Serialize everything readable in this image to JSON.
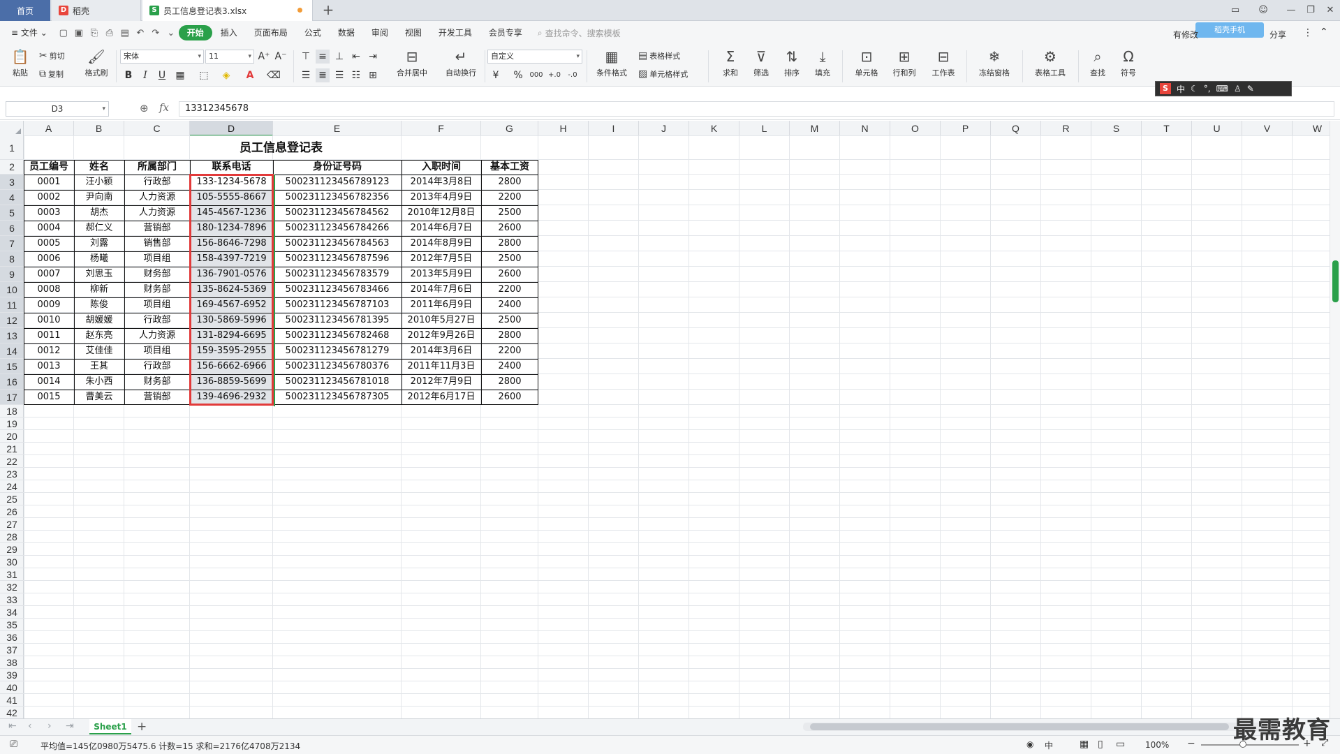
{
  "tabs": {
    "home": "首页",
    "daoke": "稻壳",
    "file": "员工信息登记表3.xlsx"
  },
  "menu": {
    "file": "文件",
    "items": [
      "开始",
      "插入",
      "页面布局",
      "公式",
      "数据",
      "审阅",
      "视图",
      "开发工具",
      "会员专享"
    ],
    "search_placeholder": "查找命令、搜索模板",
    "has_changes": "有修改",
    "share": "分享",
    "promo": "稻壳手机"
  },
  "ribbon": {
    "paste": "粘贴",
    "cut": "剪切",
    "copy": "复制",
    "format_painter": "格式刷",
    "font": "宋体",
    "font_size": "11",
    "number_format": "自定义",
    "merge_center": "合并居中",
    "auto_wrap": "自动换行",
    "table_style": "表格样式",
    "cond_format": "条件格式",
    "cell_style": "单元格样式",
    "sum": "求和",
    "filter": "筛选",
    "sort": "排序",
    "fill": "填充",
    "cell": "单元格",
    "row_col": "行和列",
    "worksheet": "工作表",
    "freeze": "冻结窗格",
    "table_tools": "表格工具",
    "find": "查找",
    "symbol": "符号"
  },
  "ime": {
    "mode": "中"
  },
  "formula_bar": {
    "name_box": "D3",
    "fx": "fx",
    "value": "13312345678"
  },
  "grid": {
    "columns": [
      "A",
      "B",
      "C",
      "D",
      "E",
      "F",
      "G",
      "H",
      "I",
      "J",
      "K",
      "L",
      "M",
      "N",
      "O",
      "P",
      "Q",
      "R",
      "S",
      "T",
      "U",
      "V",
      "W"
    ],
    "selected_column": "D",
    "row_count": 42,
    "title": "员工信息登记表",
    "headers": [
      "员工编号",
      "姓名",
      "所属部门",
      "联系电话",
      "身份证号码",
      "入职时间",
      "基本工资"
    ],
    "rows": [
      [
        "0001",
        "汪小颖",
        "行政部",
        "133-1234-5678",
        "500231123456789123",
        "2014年3月8日",
        "2800"
      ],
      [
        "0002",
        "尹向南",
        "人力资源",
        "105-5555-8667",
        "500231123456782356",
        "2013年4月9日",
        "2200"
      ],
      [
        "0003",
        "胡杰",
        "人力资源",
        "145-4567-1236",
        "500231123456784562",
        "2010年12月8日",
        "2500"
      ],
      [
        "0004",
        "郝仁义",
        "营销部",
        "180-1234-7896",
        "500231123456784266",
        "2014年6月7日",
        "2600"
      ],
      [
        "0005",
        "刘露",
        "销售部",
        "156-8646-7298",
        "500231123456784563",
        "2014年8月9日",
        "2800"
      ],
      [
        "0006",
        "杨曦",
        "项目组",
        "158-4397-7219",
        "500231123456787596",
        "2012年7月5日",
        "2500"
      ],
      [
        "0007",
        "刘思玉",
        "财务部",
        "136-7901-0576",
        "500231123456783579",
        "2013年5月9日",
        "2600"
      ],
      [
        "0008",
        "柳新",
        "财务部",
        "135-8624-5369",
        "500231123456783466",
        "2014年7月6日",
        "2200"
      ],
      [
        "0009",
        "陈俊",
        "项目组",
        "169-4567-6952",
        "500231123456787103",
        "2011年6月9日",
        "2400"
      ],
      [
        "0010",
        "胡媛媛",
        "行政部",
        "130-5869-5996",
        "500231123456781395",
        "2010年5月27日",
        "2500"
      ],
      [
        "0011",
        "赵东亮",
        "人力资源",
        "131-8294-6695",
        "500231123456782468",
        "2012年9月26日",
        "2800"
      ],
      [
        "0012",
        "艾佳佳",
        "项目组",
        "159-3595-2955",
        "500231123456781279",
        "2014年3月6日",
        "2200"
      ],
      [
        "0013",
        "王其",
        "行政部",
        "156-6662-6966",
        "500231123456780376",
        "2011年11月3日",
        "2400"
      ],
      [
        "0014",
        "朱小西",
        "财务部",
        "136-8859-5699",
        "500231123456781018",
        "2012年7月9日",
        "2800"
      ],
      [
        "0015",
        "曹美云",
        "营销部",
        "139-4696-2932",
        "500231123456787305",
        "2012年6月17日",
        "2600"
      ]
    ]
  },
  "sheets": {
    "active": "Sheet1"
  },
  "status": {
    "stats": "平均值=145亿0980万5475.6  计数=15  求和=2176亿4708万2134",
    "zoom": "100%",
    "ime_indicator": "中"
  },
  "watermark": "最需教育",
  "colors": {
    "accent": "#2aa04a",
    "selection_border": "#e23a3a",
    "home_tab": "#4b6ea8"
  }
}
